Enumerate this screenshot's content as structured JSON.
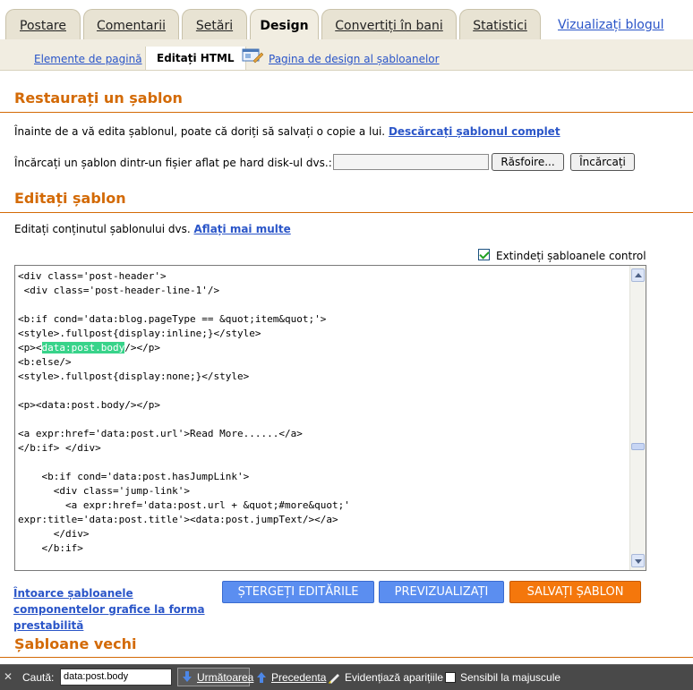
{
  "tabs": [
    {
      "label": "Postare"
    },
    {
      "label": "Comentarii"
    },
    {
      "label": "Setări"
    },
    {
      "label": "Design"
    },
    {
      "label": "Convertiți în bani"
    },
    {
      "label": "Statistici"
    }
  ],
  "view_blog": "Vizualizați blogul",
  "subtabs": {
    "page_elements": "Elemente de pagină",
    "edit_html": "Editați HTML",
    "template_designer": "Pagina de design al șabloanelor"
  },
  "restore": {
    "heading": "Restaurați un șablon",
    "intro": "Înainte de a vă edita șablonul, poate că doriți să salvați o copie a lui.",
    "download_link": "Descărcați șablonul complet",
    "upload_label": "Încărcați un șablon dintr-un fișier aflat pe hard disk-ul dvs.:",
    "browse_button": "Răsfoire...",
    "upload_button": "Încărcați"
  },
  "edit": {
    "heading": "Editați șablon",
    "intro": "Editați conținutul șablonului dvs.",
    "learn_more": "Aflați mai multe",
    "expand_widgets": "Extindeți șabloanele control",
    "expand_checked": true
  },
  "code": {
    "before_highlight": "<div class='post-header'>\n <div class='post-header-line-1'/>\n\n<b:if cond='data:blog.pageType == &quot;item&quot;'>\n<style>.fullpost{display:inline;}</style>\n<p><",
    "highlight": "data:post.body",
    "after_highlight": "/></p>\n<b:else/>\n<style>.fullpost{display:none;}</style>\n\n<p><data:post.body/></p>\n\n<a expr:href='data:post.url'>Read More......</a>\n</b:if> </div>\n\n    <b:if cond='data:post.hasJumpLink'>\n      <div class='jump-link'>\n        <a expr:href='data:post.url + &quot;#more&quot;'\nexpr:title='data:post.title'><data:post.jumpText/></a>\n      </div>\n    </b:if>"
  },
  "actions": {
    "revert": "Întoarce șabloanele componentelor grafice la forma prestabilită",
    "clear": "ȘTERGEȚI EDITĂRILE",
    "preview": "PREVIZUALIZAȚI",
    "save": "SALVAȚI ȘABLON"
  },
  "old_templates_heading": "Șabloane vechi",
  "findbar": {
    "label": "Caută:",
    "query": "data:post.body",
    "next": "Următoarea",
    "previous": "Precedenta",
    "highlight": "Evidențiază aparițiile",
    "match_case": "Sensibil la majuscule"
  },
  "colors": {
    "accent": "#d36a06",
    "link": "#2a55c8",
    "blue_button": "#5b8ef0",
    "orange_button": "#f4770c"
  }
}
